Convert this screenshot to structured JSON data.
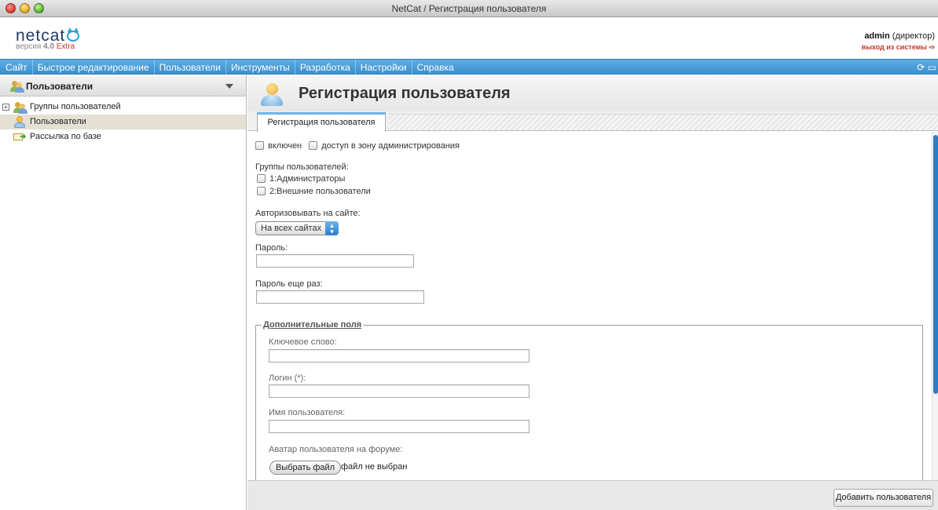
{
  "window": {
    "title": "NetCat / Регистрация пользователя"
  },
  "header": {
    "logo": "netcat",
    "version_prefix": "версия",
    "version_number": "4.0",
    "version_edition": "Extra",
    "user_name": "admin",
    "user_role": "(директор)",
    "logout": "выход из системы"
  },
  "menu": {
    "items": [
      "Сайт",
      "Быстрое редактирование",
      "Пользователи",
      "Инструменты",
      "Разработка",
      "Настройки",
      "Справка"
    ]
  },
  "sidebar": {
    "title": "Пользователи",
    "tree": [
      {
        "label": "Группы пользователей",
        "icon": "users-group-icon",
        "expander": "+"
      },
      {
        "label": "Пользователи",
        "icon": "user-icon",
        "selected": true
      },
      {
        "label": "Рассылка по базе",
        "icon": "mail-send-icon"
      }
    ]
  },
  "page": {
    "title": "Регистрация пользователя",
    "tab": "Регистрация пользователя"
  },
  "form": {
    "enabled_label": "включен",
    "admin_access_label": "доступ в зону администрирования",
    "groups_label": "Группы пользователей:",
    "groups": [
      "1:Администраторы",
      "2:Внешние пользователи"
    ],
    "authorize_label": "Авторизовывать на сайте:",
    "authorize_value": "На всех сайтах",
    "password_label": "Пароль:",
    "password_value": "",
    "password_repeat_label": "Пароль еще раз:",
    "password_repeat_value": "",
    "extra": {
      "legend": "Дополнительные поля",
      "keyword_label": "Ключевое слово:",
      "keyword_value": "",
      "login_label": "Логин (*):",
      "login_value": "",
      "username_label": "Имя пользователя:",
      "username_value": "",
      "avatar_label": "Аватар пользователя на форуме:",
      "file_button": "Выбрать файл",
      "file_status": "файл не выбран"
    }
  },
  "footer": {
    "add_button": "Добавить пользователя"
  },
  "colors": {
    "menubar": "#3c8fcd",
    "accent_red": "#c0392b",
    "selection": "#e5e0d4"
  }
}
